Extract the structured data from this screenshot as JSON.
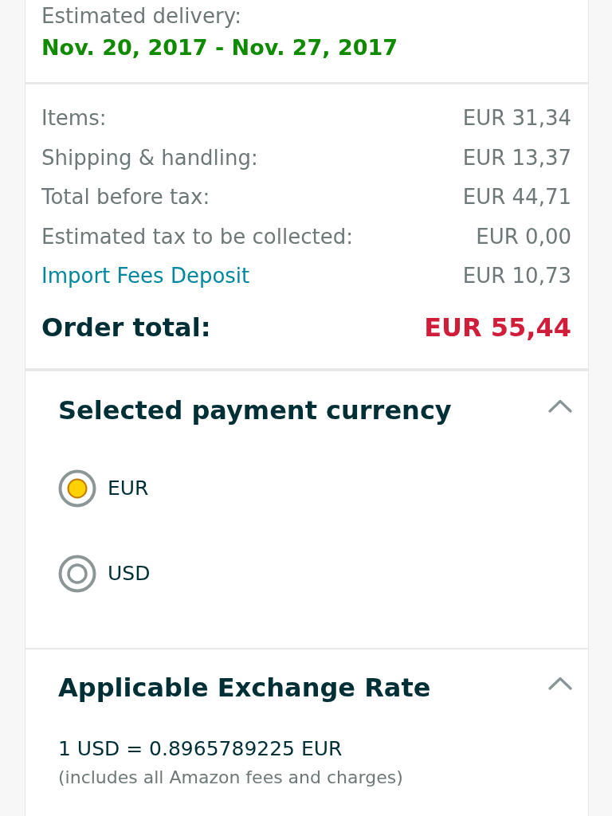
{
  "delivery": {
    "label": "Estimated delivery:",
    "dates": "Nov. 20, 2017 - Nov. 27, 2017"
  },
  "summary": {
    "lines": [
      {
        "kind": "text",
        "label": "Items:",
        "amount": "EUR 31,34"
      },
      {
        "kind": "text",
        "label": "Shipping & handling:",
        "amount": "EUR 13,37"
      },
      {
        "kind": "text",
        "label": "Total before tax:",
        "amount": "EUR 44,71"
      },
      {
        "kind": "text",
        "label": "Estimated tax to be collected:",
        "amount": "EUR 0,00"
      },
      {
        "kind": "link",
        "label": "Import Fees Deposit",
        "amount": "EUR 10,73"
      }
    ],
    "total": {
      "label": "Order total:",
      "amount": "EUR 55,44"
    }
  },
  "currency_section": {
    "title": "Selected payment currency",
    "expanded": true,
    "options": [
      {
        "label": "EUR",
        "selected": true
      },
      {
        "label": "USD",
        "selected": false
      }
    ]
  },
  "exchange_section": {
    "title": "Applicable Exchange Rate",
    "expanded": true,
    "rate": "1 USD = 0.8965789225 EUR",
    "note": "(includes all Amazon fees and charges)"
  }
}
